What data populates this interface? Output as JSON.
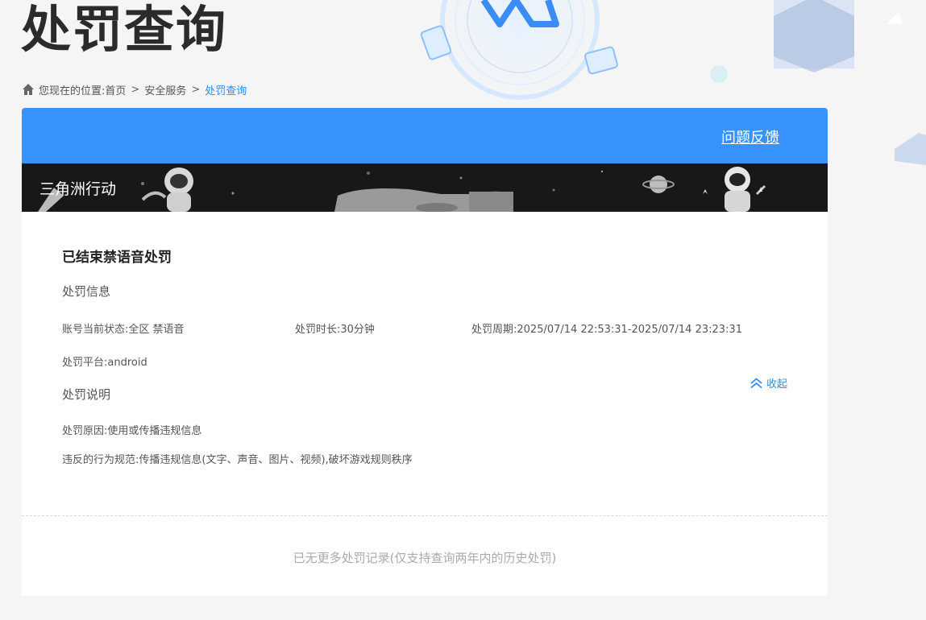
{
  "page": {
    "title": "处罚查询"
  },
  "breadcrumb": {
    "prefix": "您现在的位置:",
    "items": [
      "首页",
      "安全服务",
      "处罚查询"
    ],
    "separator": ">"
  },
  "header": {
    "feedback_label": "问题反馈",
    "accent_color": "#3894fd"
  },
  "game": {
    "name": "三角洲行动"
  },
  "record": {
    "title": "已结束禁语音处罚",
    "info_section_title": "处罚信息",
    "status": "账号当前状态:全区 禁语音",
    "duration": "处罚时长:30分钟",
    "period": "处罚周期:2025/07/14 22:53:31-2025/07/14 23:23:31",
    "platform": "处罚平台:android",
    "desc_section_title": "处罚说明",
    "reason": "处罚原因:使用或传播违规信息",
    "rule": "违反的行为规范:传播违规信息(文字、声音、图片、视频),破坏游戏规则秩序",
    "collapse_label": "收起"
  },
  "footer": {
    "no_more_text": "已无更多处罚记录(仅支持查询两年内的历史处罚)"
  },
  "icons": {
    "home": "home-icon",
    "collapse": "chevron-up-double-icon"
  }
}
